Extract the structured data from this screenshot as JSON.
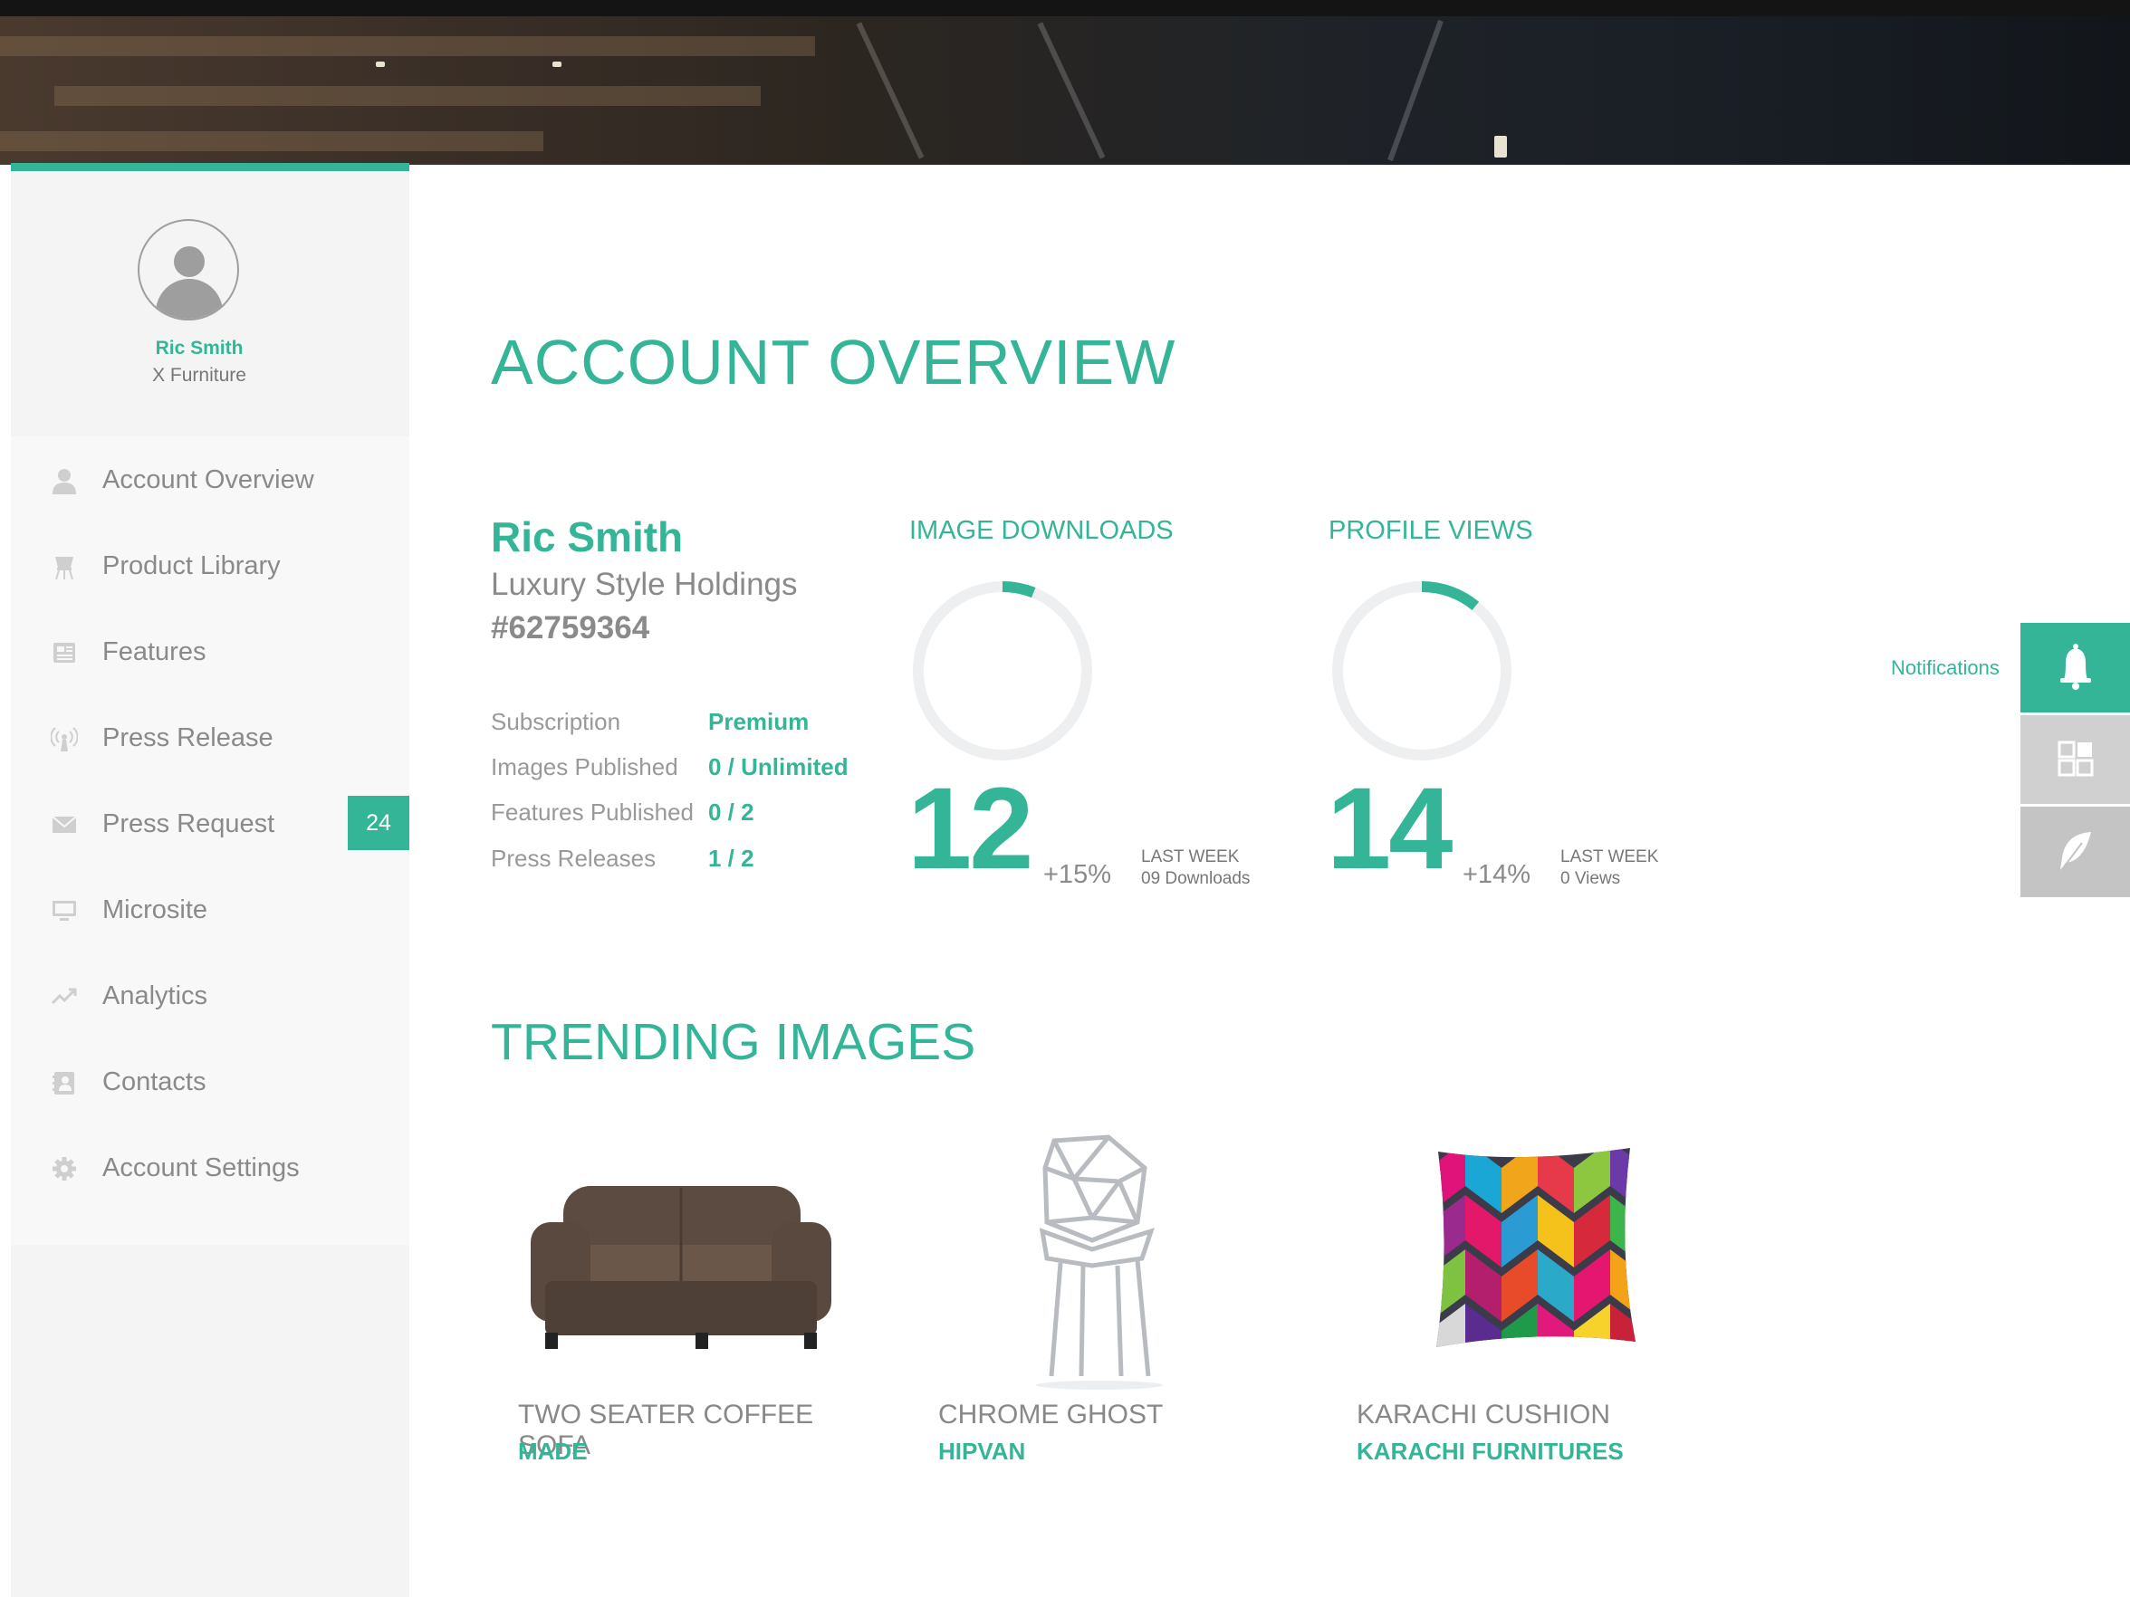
{
  "sidebar": {
    "profile": {
      "name": "Ric Smith",
      "company": "X Furniture"
    },
    "menu": [
      {
        "label": "Account Overview",
        "icon": "user-icon"
      },
      {
        "label": "Product Library",
        "icon": "chair-icon"
      },
      {
        "label": "Features",
        "icon": "newspaper-icon"
      },
      {
        "label": "Press Release",
        "icon": "broadcast-icon"
      },
      {
        "label": "Press Request",
        "icon": "envelope-icon",
        "badge": "24"
      },
      {
        "label": "Microsite",
        "icon": "monitor-icon"
      },
      {
        "label": "Analytics",
        "icon": "trend-icon"
      },
      {
        "label": "Contacts",
        "icon": "address-book-icon"
      },
      {
        "label": "Account Settings",
        "icon": "gear-icon"
      }
    ]
  },
  "main": {
    "title": "ACCOUNT OVERVIEW",
    "account": {
      "name": "Ric Smith",
      "company": "Luxury Style Holdings",
      "id": "#62759364",
      "stats": [
        {
          "label": "Subscription",
          "value": "Premium"
        },
        {
          "label": "Images Published",
          "value": "0 / Unlimited"
        },
        {
          "label": "Features Published",
          "value": "0 / 2"
        },
        {
          "label": "Press Releases",
          "value": "1 / 2"
        }
      ]
    },
    "kpis": [
      {
        "title": "IMAGE DOWNLOADS",
        "value": "12",
        "change": "+15%",
        "last_week_label": "LAST WEEK",
        "last_week_value": "09 Downloads",
        "ring_fraction": 0.06
      },
      {
        "title": "PROFILE VIEWS",
        "value": "14",
        "change": "+14%",
        "last_week_label": "LAST WEEK",
        "last_week_value": "0 Views",
        "ring_fraction": 0.11
      }
    ],
    "trending_title": "TRENDING IMAGES",
    "products": [
      {
        "name": "TWO SEATER COFFEE SOFA",
        "brand": "MADE",
        "image": "sofa"
      },
      {
        "name": "CHROME GHOST",
        "brand": "HIPVAN",
        "image": "chrome-chair"
      },
      {
        "name": "KARACHI CUSHION",
        "brand": "KARACHI FURNITURES",
        "image": "cushion"
      }
    ]
  },
  "dock": {
    "notifications_label": "Notifications",
    "buttons": [
      "bell-icon",
      "grid-icon",
      "feather-icon"
    ]
  },
  "colors": {
    "accent": "#35b597",
    "ring_track": "#eeeff0",
    "sidebar_bg": "#f4f4f4",
    "dock_inactive": "#d0d0d0"
  }
}
